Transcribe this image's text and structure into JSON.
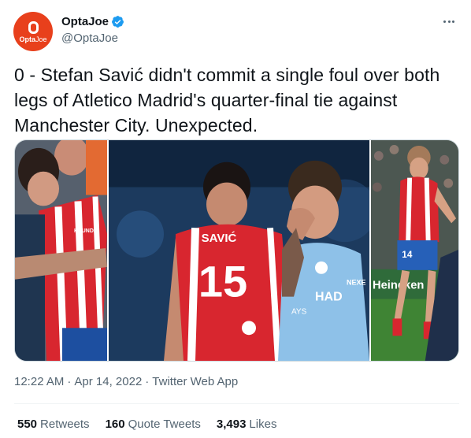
{
  "account": {
    "display_name": "OptaJoe",
    "handle": "@OptaJoe",
    "avatar_text": "Opta",
    "avatar_text_2": "Joe",
    "verified": true
  },
  "tweet": {
    "text": "0 - Stefan Savić didn't commit a single foul over both legs of Atletico Madrid's quarter-final tie against Manchester City. Unexpected.",
    "time": "12:22 AM",
    "date": "Apr 14, 2022",
    "source": "Twitter Web App"
  },
  "media": {
    "images": [
      {
        "shirt_text": "HYUNDAI"
      },
      {
        "player_name": "SAVIĆ",
        "player_number": "15",
        "opponent_sponsor": "HAD",
        "opponent_sponsor_2": "AYS",
        "board_text": "NEXE"
      },
      {
        "player_number": "14",
        "board_text": "Heineken"
      }
    ]
  },
  "stats": {
    "retweets_count": "550",
    "retweets_label": "Retweets",
    "quotes_count": "160",
    "quotes_label": "Quote Tweets",
    "likes_count": "3,493",
    "likes_label": "Likes"
  },
  "colors": {
    "brand_orange": "#e8401c",
    "verified_blue": "#1d9bf0",
    "secondary_text": "#536471",
    "atletico_red": "#d8262f",
    "city_blue": "#8ec1e8"
  }
}
